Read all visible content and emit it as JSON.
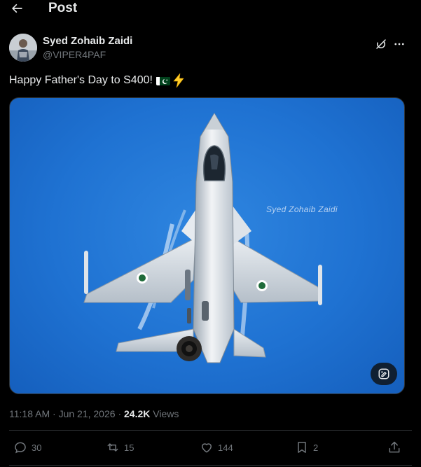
{
  "header": {
    "title": "Post"
  },
  "author": {
    "name": "Syed Zohaib Zaidi",
    "handle": "@VIPER4PAF"
  },
  "post": {
    "text": "Happy Father's Day to S400!",
    "emojis": [
      "pakistan-flag",
      "high-voltage"
    ],
    "image_watermark": "Syed Zohaib Zaidi"
  },
  "meta": {
    "time": "11:18 AM",
    "separator": "·",
    "date": "Jun 21, 2026",
    "views_count": "24.2K",
    "views_label": "Views"
  },
  "actions": {
    "replies": "30",
    "reposts": "15",
    "likes": "144",
    "bookmarks": "2"
  },
  "colors": {
    "background": "#000000",
    "text": "#e7e9ea",
    "secondary": "#71767b",
    "border": "#2f3336",
    "sky": "#1f72d2"
  }
}
